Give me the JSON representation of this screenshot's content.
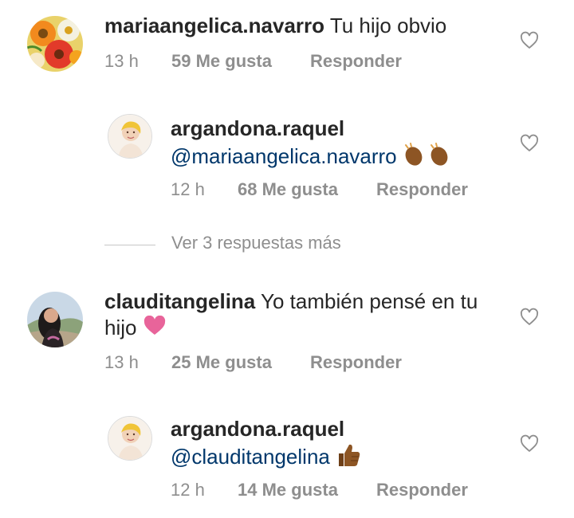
{
  "comments": [
    {
      "username": "mariaangelica.navarro",
      "text": "Tu hijo obvio",
      "time": "13 h",
      "likes": "59 Me gusta",
      "reply": "Responder",
      "reply_item": {
        "username": "argandona.raquel",
        "mention": "@mariaangelica.navarro",
        "emoji": [
          "clapping-hands",
          "clapping-hands"
        ],
        "time": "12 h",
        "likes": "68 Me gusta",
        "reply": "Responder"
      }
    },
    {
      "username": "clauditangelina",
      "text_line1": "Yo también pensé en tu",
      "text_line2": "hijo",
      "emoji": "pink-heart",
      "time": "13 h",
      "likes": "25 Me gusta",
      "reply": "Responder",
      "reply_item": {
        "username": "argandona.raquel",
        "mention": "@clauditangelina",
        "emoji": "thumbs-up",
        "time": "12 h",
        "likes": "14 Me gusta",
        "reply": "Responder"
      }
    }
  ],
  "view_more": "Ver 3 respuestas más",
  "colors": {
    "text": "#262626",
    "meta": "#8e8e8e",
    "mention": "#00376b",
    "heart_emoji": "#e8649a",
    "skin_emoji": "#8d5524"
  }
}
